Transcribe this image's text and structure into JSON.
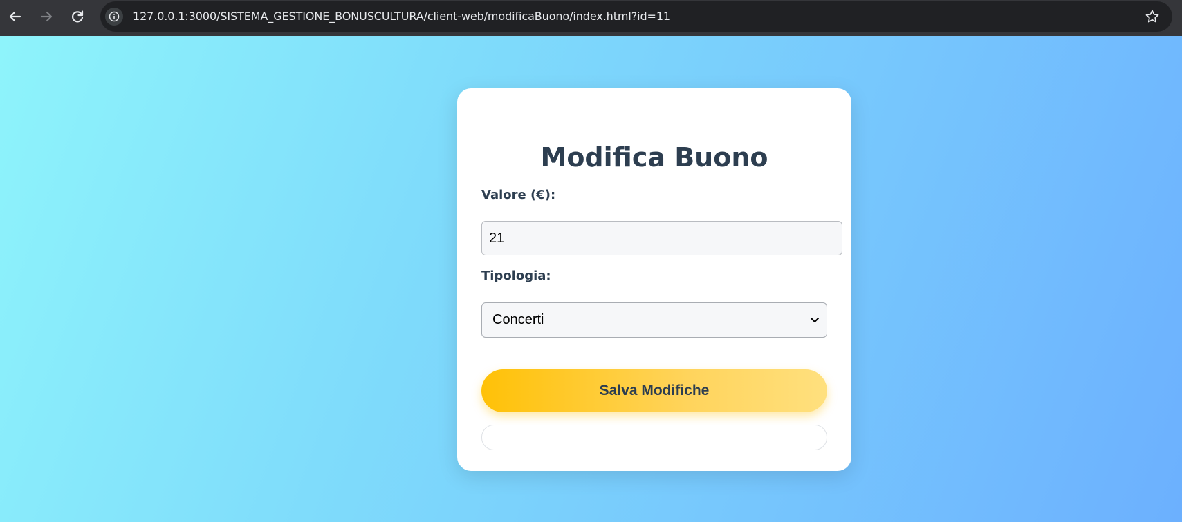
{
  "browser": {
    "url": "127.0.0.1:3000/SISTEMA_GESTIONE_BONUSCULTURA/client-web/modificaBuono/index.html?id=11",
    "back_icon": "arrow-left-icon",
    "forward_icon": "arrow-right-icon",
    "reload_icon": "reload-icon",
    "site_info_icon": "info-icon",
    "bookmark_icon": "star-icon"
  },
  "form": {
    "title": "Modifica Buono",
    "valore_label": "Valore (€):",
    "valore_value": "21",
    "tipologia_label": "Tipologia:",
    "tipologia_selected": "Concerti",
    "save_label": "Salva Modifiche",
    "message": ""
  },
  "colors": {
    "browser_bar": "#35363a",
    "title_text": "#2d3e50",
    "button_start": "#ffc107",
    "button_end": "#ffe07e",
    "background_start": "#8ef4fb",
    "background_end": "#6cb0fe"
  }
}
